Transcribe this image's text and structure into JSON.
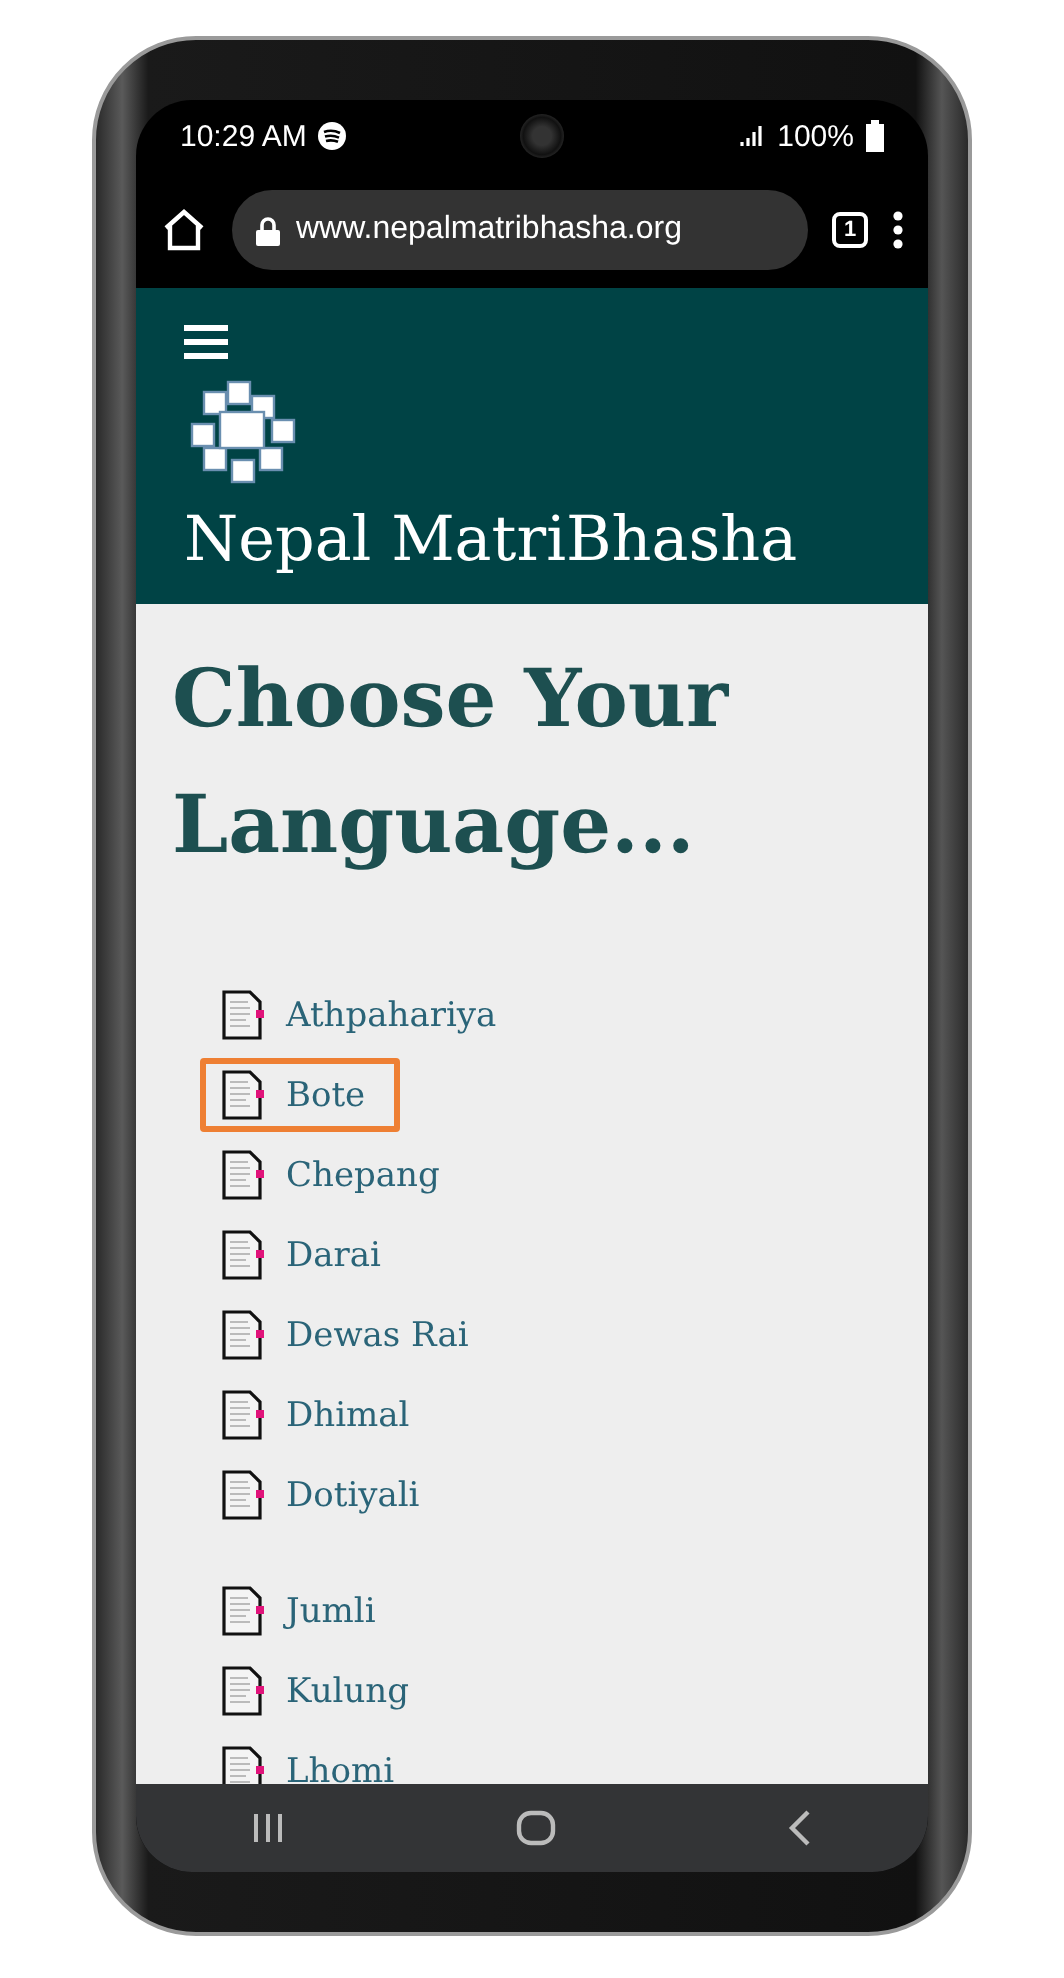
{
  "status_bar": {
    "time": "10:29 AM",
    "battery": "100%"
  },
  "browser": {
    "url": "www.nepalmatribhasha.org",
    "tab_count": "1"
  },
  "site": {
    "title": "Nepal MatriBhasha"
  },
  "heading": "Choose Your Language...",
  "language_groups": [
    [
      {
        "name": "Athpahariya",
        "selected": false
      },
      {
        "name": "Bote",
        "selected": true
      },
      {
        "name": "Chepang",
        "selected": false
      },
      {
        "name": "Darai",
        "selected": false
      },
      {
        "name": "Dewas Rai",
        "selected": false
      },
      {
        "name": "Dhimal",
        "selected": false
      },
      {
        "name": "Dotiyali",
        "selected": false
      }
    ],
    [
      {
        "name": "Jumli",
        "selected": false
      },
      {
        "name": "Kulung",
        "selected": false
      },
      {
        "name": "Lhomi",
        "selected": false
      }
    ]
  ]
}
